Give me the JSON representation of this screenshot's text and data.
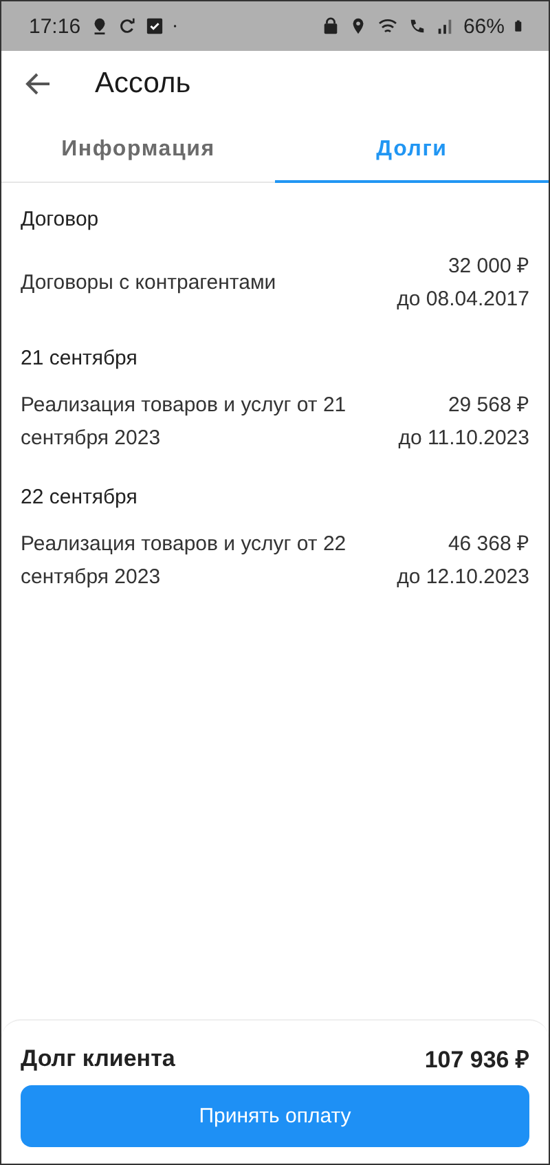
{
  "status_bar": {
    "time": "17:16",
    "battery": "66%"
  },
  "header": {
    "title": "Ассоль"
  },
  "tabs": [
    {
      "label": "Информация",
      "selected": false
    },
    {
      "label": "Долги",
      "selected": true
    }
  ],
  "groups": [
    {
      "title": "Договор",
      "items": [
        {
          "name": "Договоры с контрагентами",
          "amount": "32 000 ₽",
          "due": "до 08.04.2017"
        }
      ]
    },
    {
      "title": "21 сентября",
      "items": [
        {
          "name": "Реализация товаров и услуг от 21 сентября 2023",
          "amount": "29 568 ₽",
          "due": "до 11.10.2023"
        }
      ]
    },
    {
      "title": "22 сентября",
      "items": [
        {
          "name": "Реализация товаров и услуг от 22 сентября 2023",
          "amount": "46 368 ₽",
          "due": "до 12.10.2023"
        }
      ]
    }
  ],
  "footer": {
    "label": "Долг клиента",
    "total": "107 936 ₽",
    "button": "Принять оплату"
  }
}
